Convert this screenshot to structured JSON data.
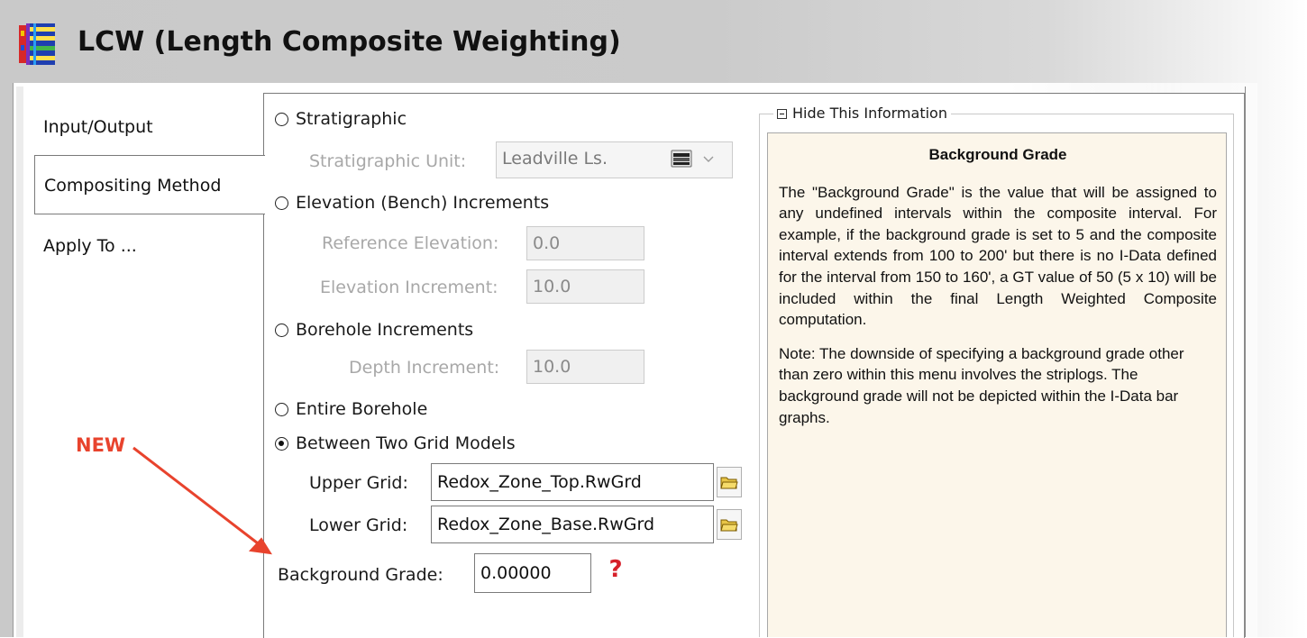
{
  "window": {
    "title": "LCW (Length Composite Weighting)"
  },
  "tabs": [
    {
      "label": "Input/Output",
      "active": false
    },
    {
      "label": "Compositing Method",
      "active": true
    },
    {
      "label": "Apply To ...",
      "active": false
    }
  ],
  "options": {
    "stratigraphic": {
      "label": "Stratigraphic",
      "selected": false,
      "unit_label": "Stratigraphic Unit:",
      "unit_value": "Leadville Ls."
    },
    "elevation": {
      "label": "Elevation (Bench) Increments",
      "selected": false,
      "reference_label": "Reference Elevation:",
      "reference_value": "0.0",
      "increment_label": "Elevation Increment:",
      "increment_value": "10.0"
    },
    "borehole": {
      "label": "Borehole Increments",
      "selected": false,
      "depth_label": "Depth Increment:",
      "depth_value": "10.0"
    },
    "entire": {
      "label": "Entire Borehole",
      "selected": false
    },
    "grid_models": {
      "label": "Between Two Grid Models",
      "selected": true,
      "upper_label": "Upper Grid:",
      "upper_value": "Redox_Zone_Top.RwGrd",
      "lower_label": "Lower Grid:",
      "lower_value": "Redox_Zone_Base.RwGrd"
    }
  },
  "background_grade": {
    "label": "Background Grade:",
    "value": "0.00000"
  },
  "info": {
    "toggle_label": "Hide This Information",
    "heading": "Background Grade",
    "paragraph1": "The \"Background Grade\" is the value that will be assigned to any undefined intervals within the composite interval.   For example, if the background grade is set to 5 and the composite interval extends from 100 to 200' but there is no I-Data defined for the interval from 150 to 160', a GT value of 50 (5 x 10) will be included within the final Length Weighted Composite computation.",
    "paragraph2": "Note: The downside of specifying a background grade other than zero within this menu involves the striplogs.  The background grade will not be depicted within the I-Data bar graphs."
  },
  "annotation": {
    "text": "NEW",
    "color": "#e8432d"
  },
  "colors": {
    "info_background": "#fcf6ea",
    "help_icon": "#d6202a",
    "disabled_text": "#a8a8a8"
  },
  "icons": {
    "app": "striplog-app-icon",
    "unit_picker": "layers-icon",
    "folder": "folder-open-icon",
    "help": "question-mark-icon",
    "collapse": "minus-box-icon"
  }
}
